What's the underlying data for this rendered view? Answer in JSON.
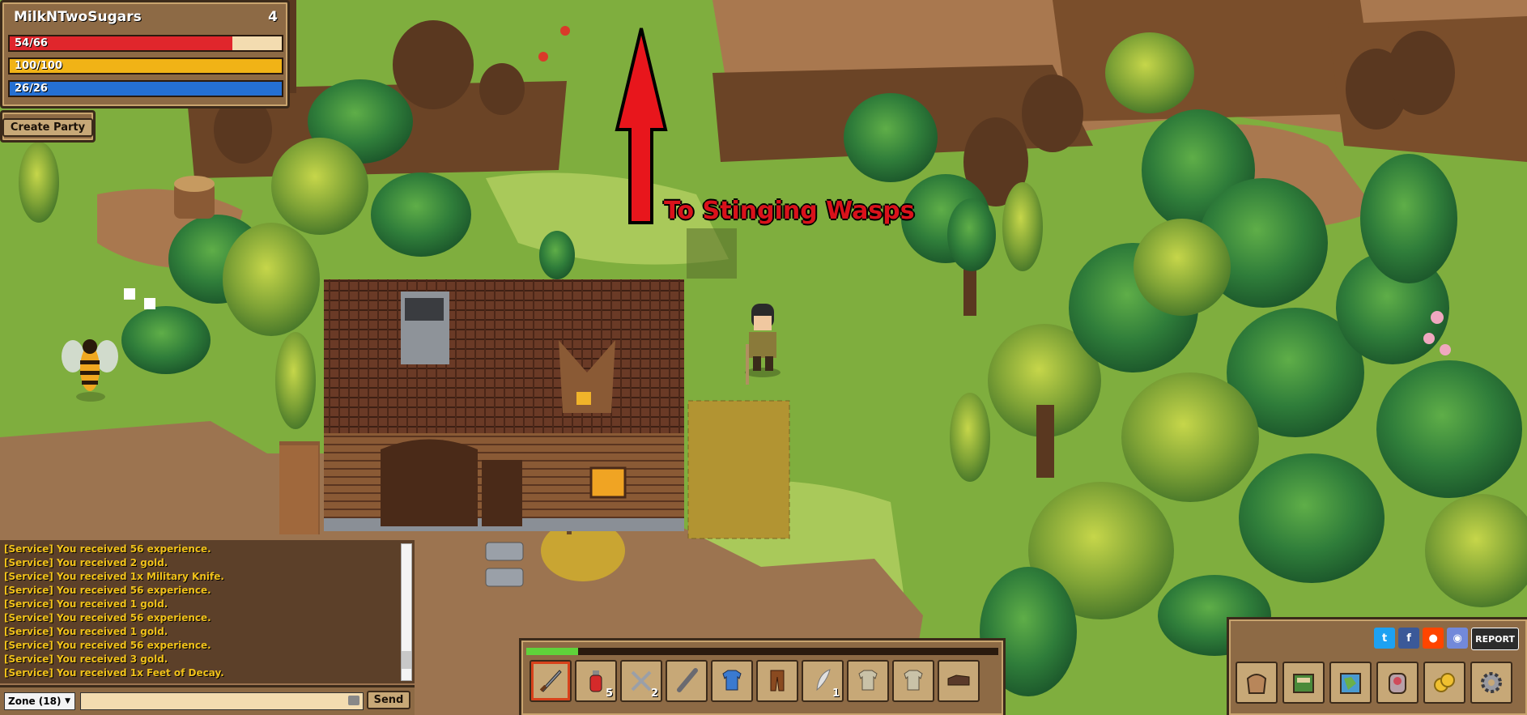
{
  "player": {
    "name": "MilkNTwoSugars",
    "level": "4",
    "hp": {
      "text": "54/66",
      "fraction": 0.818
    },
    "food": {
      "text": "100/100",
      "fraction": 1.0
    },
    "mana": {
      "text": "26/26",
      "fraction": 1.0
    }
  },
  "party": {
    "create_label": "Create Party"
  },
  "map": {
    "sign_text": "To Stinging Wasps",
    "arrow_direction": "north"
  },
  "chat": {
    "lines": [
      "[Service] You received 56 experience.",
      "[Service] You received 2 gold.",
      "[Service] You received 1x Military Knife.",
      "[Service] You received 56 experience.",
      "[Service] You received 1 gold.",
      "[Service] You received 56 experience.",
      "[Service] You received 1 gold.",
      "[Service] You received 56 experience.",
      "[Service] You received 3 gold.",
      "[Service] You received 1x Feet of Decay."
    ],
    "zone_label": "Zone (18)",
    "input_placeholder": "",
    "send_label": "Send"
  },
  "hotbar": {
    "xp_fraction": 0.11,
    "slots": [
      {
        "icon": "sword-icon",
        "count": ""
      },
      {
        "icon": "potion-icon",
        "count": "5"
      },
      {
        "icon": "throwing-knives-icon",
        "count": "2"
      },
      {
        "icon": "club-icon",
        "count": ""
      },
      {
        "icon": "blue-shirt-icon",
        "count": ""
      },
      {
        "icon": "leather-pants-icon",
        "count": ""
      },
      {
        "icon": "feather-icon",
        "count": "1"
      },
      {
        "icon": "shirt-icon",
        "count": ""
      },
      {
        "icon": "shirt-icon",
        "count": ""
      },
      {
        "icon": "boots-icon",
        "count": ""
      }
    ]
  },
  "menu": {
    "social": [
      "twitter-icon",
      "facebook-icon",
      "reddit-icon",
      "discord-icon"
    ],
    "report_label": "REPORT",
    "buttons": [
      "inventory-bag-icon",
      "spellbook-icon",
      "world-map-icon",
      "character-equipment-icon",
      "gold-coins-icon",
      "settings-gear-icon"
    ]
  },
  "colors": {
    "hp": "#e0262c",
    "food": "#f1b316",
    "mana": "#2570d3",
    "chat_text": "#f0c11a",
    "sign": "#d9121b",
    "panel": "#8d6a45"
  }
}
